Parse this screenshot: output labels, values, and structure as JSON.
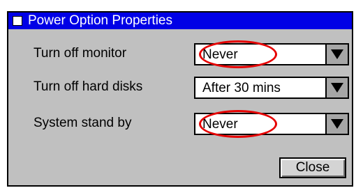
{
  "window": {
    "title": "Power Option Properties"
  },
  "settings": [
    {
      "label": "Turn off monitor",
      "value": "Never",
      "highlighted": true
    },
    {
      "label": "Turn off hard disks",
      "value": "After 30 mins",
      "highlighted": false
    },
    {
      "label": "System stand by",
      "value": "Never",
      "highlighted": true
    }
  ],
  "buttons": {
    "close_label": "Close"
  },
  "colors": {
    "titlebar": "#0000e6",
    "window_background": "#c0c0c0",
    "highlight_circle": "#e60000"
  },
  "icons": {
    "window_icon": "window-icon",
    "dropdown_arrow": "dropdown-arrow-icon"
  }
}
